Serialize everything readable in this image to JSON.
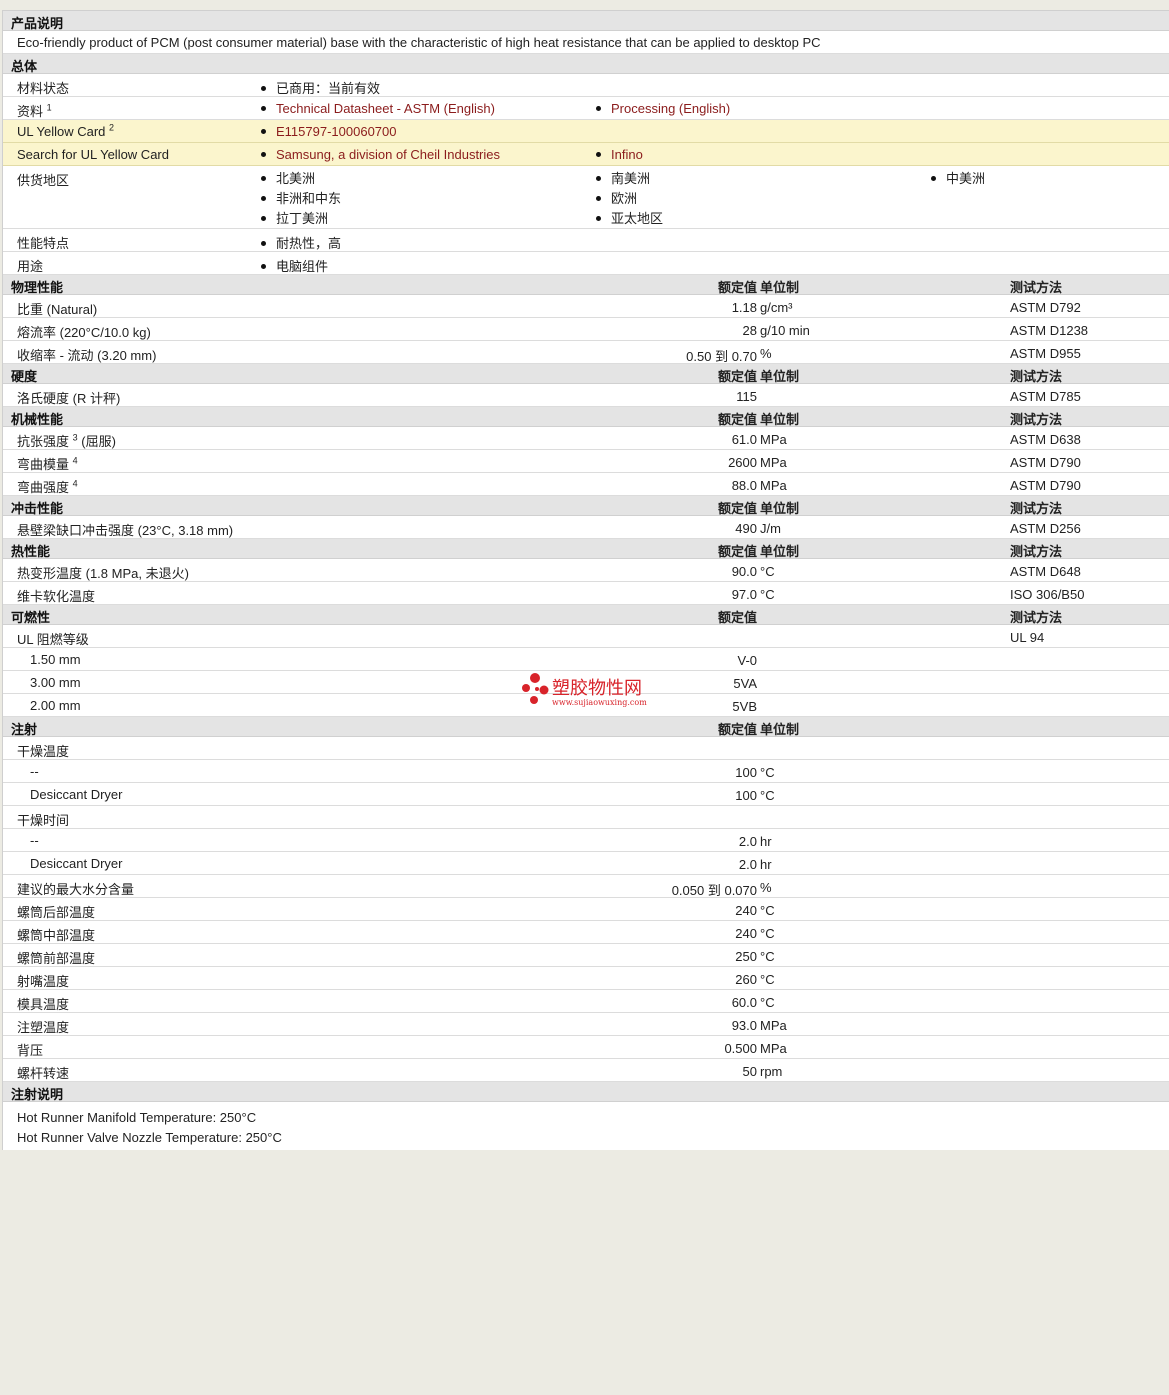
{
  "product_description": {
    "header": "产品说明",
    "text": "Eco-friendly product of PCM (post consumer material) base with the characteristic of high heat resistance that can be applied to desktop PC"
  },
  "general": {
    "header": "总体",
    "material_status": {
      "label": "材料状态",
      "value": "已商用：当前有效"
    },
    "documents": {
      "label": "资料",
      "sup": "1",
      "items": [
        "Technical Datasheet - ASTM (English)",
        "Processing (English)"
      ]
    },
    "yellow_card": {
      "label": "UL Yellow Card",
      "sup": "2",
      "value": "E115797-100060700"
    },
    "search_yellow_card": {
      "label": "Search for UL Yellow Card",
      "items": [
        "Samsung, a division of Cheil Industries",
        "Infino"
      ]
    },
    "regions": {
      "label": "供货地区",
      "col1": [
        "北美洲",
        "非洲和中东",
        "拉丁美洲"
      ],
      "col2": [
        "南美洲",
        "欧洲",
        "亚太地区"
      ],
      "col3": [
        "中美洲"
      ]
    },
    "features": {
      "label": "性能特点",
      "value": "耐热性，高"
    },
    "uses": {
      "label": "用途",
      "value": "电脑组件"
    }
  },
  "col_headers": {
    "value": "额定值",
    "unit": "单位制",
    "method": "测试方法"
  },
  "physical": {
    "header": "物理性能",
    "rows": [
      {
        "label": "比重  (Natural)",
        "value": "1.18",
        "unit": "g/cm³",
        "method": "ASTM D792"
      },
      {
        "label": "熔流率  (220°C/10.0 kg)",
        "value": "28",
        "unit": "g/10 min",
        "method": "ASTM D1238"
      },
      {
        "label": "收缩率  - 流动  (3.20 mm)",
        "value": "0.50 到  0.70",
        "unit": "%",
        "method": "ASTM D955"
      }
    ]
  },
  "hardness": {
    "header": "硬度",
    "rows": [
      {
        "label": "洛氏硬度  (R 计秤)",
        "value": "115",
        "unit": "",
        "method": "ASTM D785"
      }
    ]
  },
  "mechanical": {
    "header": "机械性能",
    "rows": [
      {
        "label": "抗张强度",
        "sup": "3",
        "suffix": " (屈服)",
        "value": "61.0",
        "unit": "MPa",
        "method": "ASTM D638"
      },
      {
        "label": "弯曲模量",
        "sup": "4",
        "suffix": "",
        "value": "2600",
        "unit": "MPa",
        "method": "ASTM D790"
      },
      {
        "label": "弯曲强度",
        "sup": "4",
        "suffix": "",
        "value": "88.0",
        "unit": "MPa",
        "method": "ASTM D790"
      }
    ]
  },
  "impact": {
    "header": "冲击性能",
    "rows": [
      {
        "label": "悬壁梁缺口冲击强度  (23°C, 3.18 mm)",
        "value": "490",
        "unit": "J/m",
        "method": "ASTM D256"
      }
    ]
  },
  "thermal": {
    "header": "热性能",
    "rows": [
      {
        "label": "热变形温度  (1.8 MPa, 未退火)",
        "value": "90.0",
        "unit": "°C",
        "method": "ASTM D648"
      },
      {
        "label": "维卡软化温度",
        "value": "97.0",
        "unit": "°C",
        "method": "ISO 306/B50"
      }
    ]
  },
  "flammability": {
    "header": "可燃性",
    "rating_label": "UL 阻燃等级",
    "rating_method": "UL 94",
    "rows": [
      {
        "label": "1.50 mm",
        "value": "V-0"
      },
      {
        "label": "3.00 mm",
        "value": "5VA"
      },
      {
        "label": "2.00 mm",
        "value": "5VB"
      }
    ]
  },
  "injection": {
    "header": "注射",
    "drying_temp": {
      "label": "干燥温度",
      "rows": [
        {
          "label": "--",
          "value": "100",
          "unit": "°C"
        },
        {
          "label": "Desiccant Dryer",
          "value": "100",
          "unit": "°C"
        }
      ]
    },
    "drying_time": {
      "label": "干燥时间",
      "rows": [
        {
          "label": "--",
          "value": "2.0",
          "unit": "hr"
        },
        {
          "label": "Desiccant Dryer",
          "value": "2.0",
          "unit": "hr"
        }
      ]
    },
    "rows": [
      {
        "label": "建议的最大水分含量",
        "value": "0.050 到  0.070",
        "unit": "%"
      },
      {
        "label": "螺筒后部温度",
        "value": "240",
        "unit": "°C"
      },
      {
        "label": "螺筒中部温度",
        "value": "240",
        "unit": "°C"
      },
      {
        "label": "螺筒前部温度",
        "value": "250",
        "unit": "°C"
      },
      {
        "label": "射嘴温度",
        "value": "260",
        "unit": "°C"
      },
      {
        "label": "模具温度",
        "value": "60.0",
        "unit": "°C"
      },
      {
        "label": "注塑温度",
        "value": "93.0",
        "unit": "MPa"
      },
      {
        "label": "背压",
        "value": "0.500",
        "unit": "MPa"
      },
      {
        "label": "螺杆转速",
        "value": "50",
        "unit": "rpm"
      }
    ]
  },
  "injection_notes": {
    "header": "注射说明",
    "lines": [
      "Hot Runner Manifold Temperature: 250°C",
      "Hot Runner Valve Nozzle Temperature: 250°C"
    ]
  },
  "watermark": {
    "title": "塑胶物性网",
    "url": "www.sujiaowuxing.com",
    "color": "#d8232a"
  }
}
